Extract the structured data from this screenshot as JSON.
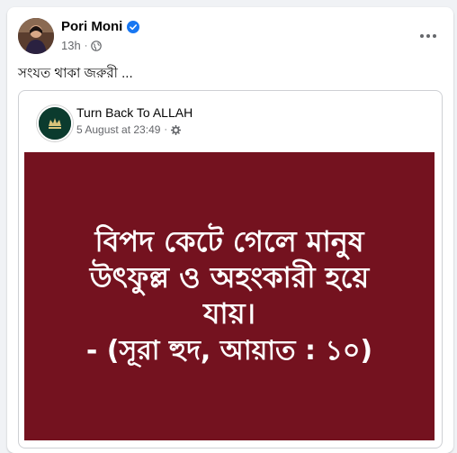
{
  "post": {
    "author": "Pori Moni",
    "time": "13h",
    "caption": "সংযত থাকা জরুরী ...",
    "icons": {
      "verified": "verified-badge-icon",
      "audience": "globe-icon",
      "more": "more-options-icon"
    }
  },
  "shared": {
    "page_name": "Turn Back To ALLAH",
    "date": "5 August at 23:49",
    "icons": {
      "settings": "gear-icon"
    },
    "quote": {
      "lines": [
        "বিপদ কেটে গেলে মানুষ",
        "উৎফুল্ল ও অহংকারী হয়ে",
        "যায়।"
      ],
      "reference": "- (সূরা হুদ, আয়াত : ১০)",
      "background_color": "#74121f"
    }
  },
  "colors": {
    "accent": "#1877f2",
    "muted_text": "#65676b"
  }
}
